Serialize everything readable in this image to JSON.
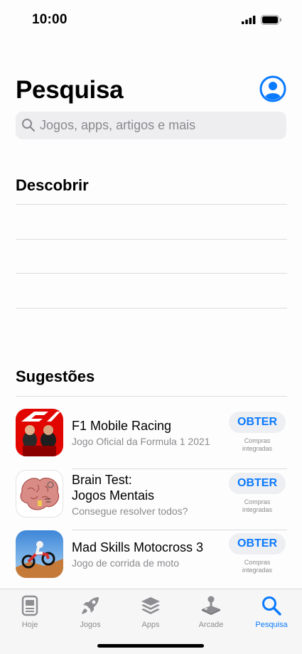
{
  "status": {
    "time": "10:00"
  },
  "header": {
    "title": "Pesquisa"
  },
  "search": {
    "placeholder": "Jogos, apps, artigos e mais"
  },
  "discover": {
    "title": "Descobrir"
  },
  "suggestions": {
    "title": "Sugestões",
    "apps": [
      {
        "name": "F1 Mobile Racing",
        "subtitle": "Jogo Oficial da Formula 1 2021",
        "button": "OBTER",
        "iap_line1": "Compras",
        "iap_line2": "integradas"
      },
      {
        "name": "Brain Test:",
        "name2": "Jogos Mentais",
        "subtitle": "Consegue resolver todos?",
        "button": "OBTER",
        "iap_line1": "Compras",
        "iap_line2": "integradas"
      },
      {
        "name": "Mad Skills Motocross 3",
        "subtitle": "Jogo de corrida de moto",
        "button": "OBTER",
        "iap_line1": "Compras",
        "iap_line2": "integradas"
      }
    ]
  },
  "tabs": [
    {
      "label": "Hoje",
      "icon": "today-icon"
    },
    {
      "label": "Jogos",
      "icon": "rocket-icon"
    },
    {
      "label": "Apps",
      "icon": "layers-icon"
    },
    {
      "label": "Arcade",
      "icon": "joystick-icon"
    },
    {
      "label": "Pesquisa",
      "icon": "search-icon",
      "active": true
    }
  ],
  "colors": {
    "accent": "#0a7aff",
    "secondary_text": "#8a8a8e"
  }
}
